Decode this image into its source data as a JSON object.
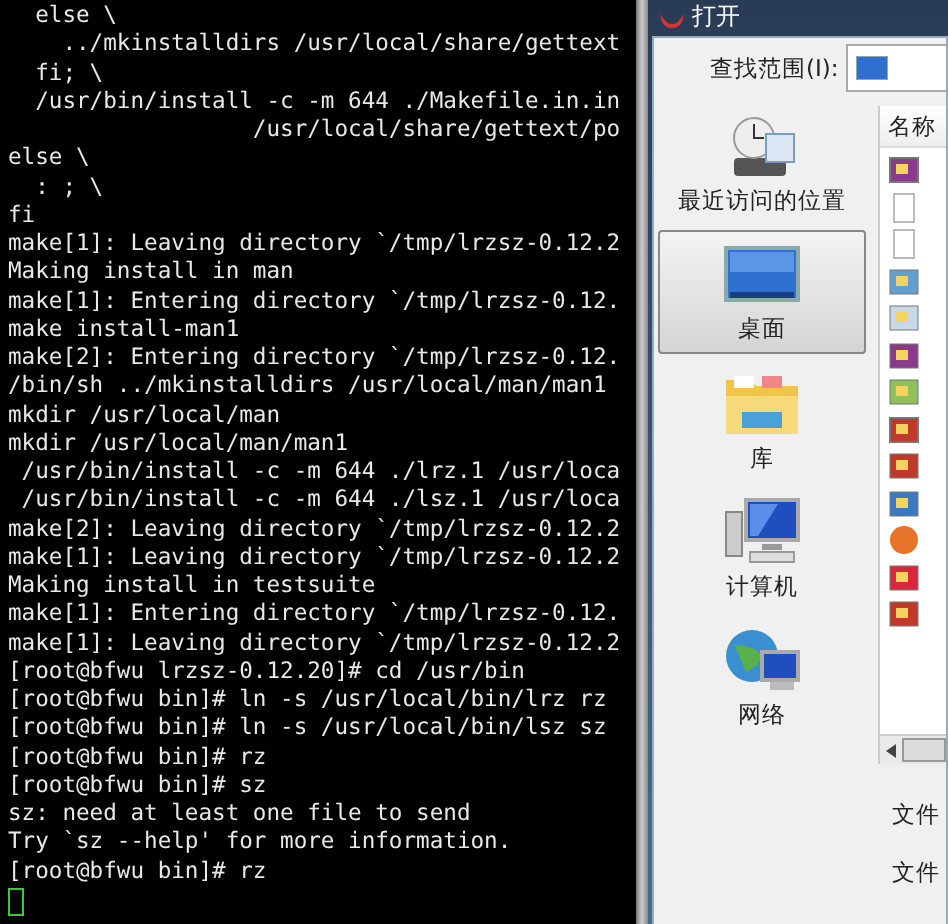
{
  "terminal": {
    "lines": [
      "  else \\",
      "    ../mkinstalldirs /usr/local/share/gettext",
      "  fi; \\",
      "  /usr/bin/install -c -m 644 ./Makefile.in.in",
      "                  /usr/local/share/gettext/po",
      "else \\",
      "  : ; \\",
      "fi",
      "make[1]: Leaving directory `/tmp/lrzsz-0.12.2",
      "Making install in man",
      "make[1]: Entering directory `/tmp/lrzsz-0.12.",
      "make install-man1",
      "make[2]: Entering directory `/tmp/lrzsz-0.12.",
      "/bin/sh ../mkinstalldirs /usr/local/man/man1",
      "mkdir /usr/local/man",
      "mkdir /usr/local/man/man1",
      " /usr/bin/install -c -m 644 ./lrz.1 /usr/loca",
      " /usr/bin/install -c -m 644 ./lsz.1 /usr/loca",
      "make[2]: Leaving directory `/tmp/lrzsz-0.12.2",
      "make[1]: Leaving directory `/tmp/lrzsz-0.12.2",
      "Making install in testsuite",
      "make[1]: Entering directory `/tmp/lrzsz-0.12.",
      "make[1]: Leaving directory `/tmp/lrzsz-0.12.2",
      "[root@bfwu lrzsz-0.12.20]# cd /usr/bin",
      "[root@bfwu bin]# ln -s /usr/local/bin/lrz rz",
      "[root@bfwu bin]# ln -s /usr/local/bin/lsz sz",
      "[root@bfwu bin]# rz",
      "[root@bfwu bin]# sz",
      "sz: need at least one file to send",
      "Try `sz --help' for more information.",
      "[root@bfwu bin]# rz"
    ]
  },
  "dialog": {
    "title": "打开",
    "look_in_label": "查找范围(I):",
    "places": [
      {
        "kind": "recent",
        "label": "最近访问的位置",
        "selected": false
      },
      {
        "kind": "desktop",
        "label": "桌面",
        "selected": true
      },
      {
        "kind": "library",
        "label": "库",
        "selected": false
      },
      {
        "kind": "computer",
        "label": "计算机",
        "selected": false
      },
      {
        "kind": "network",
        "label": "网络",
        "selected": false
      }
    ],
    "file_list": {
      "column_1": "名称"
    },
    "field_labels": [
      "文件",
      "文件"
    ]
  }
}
